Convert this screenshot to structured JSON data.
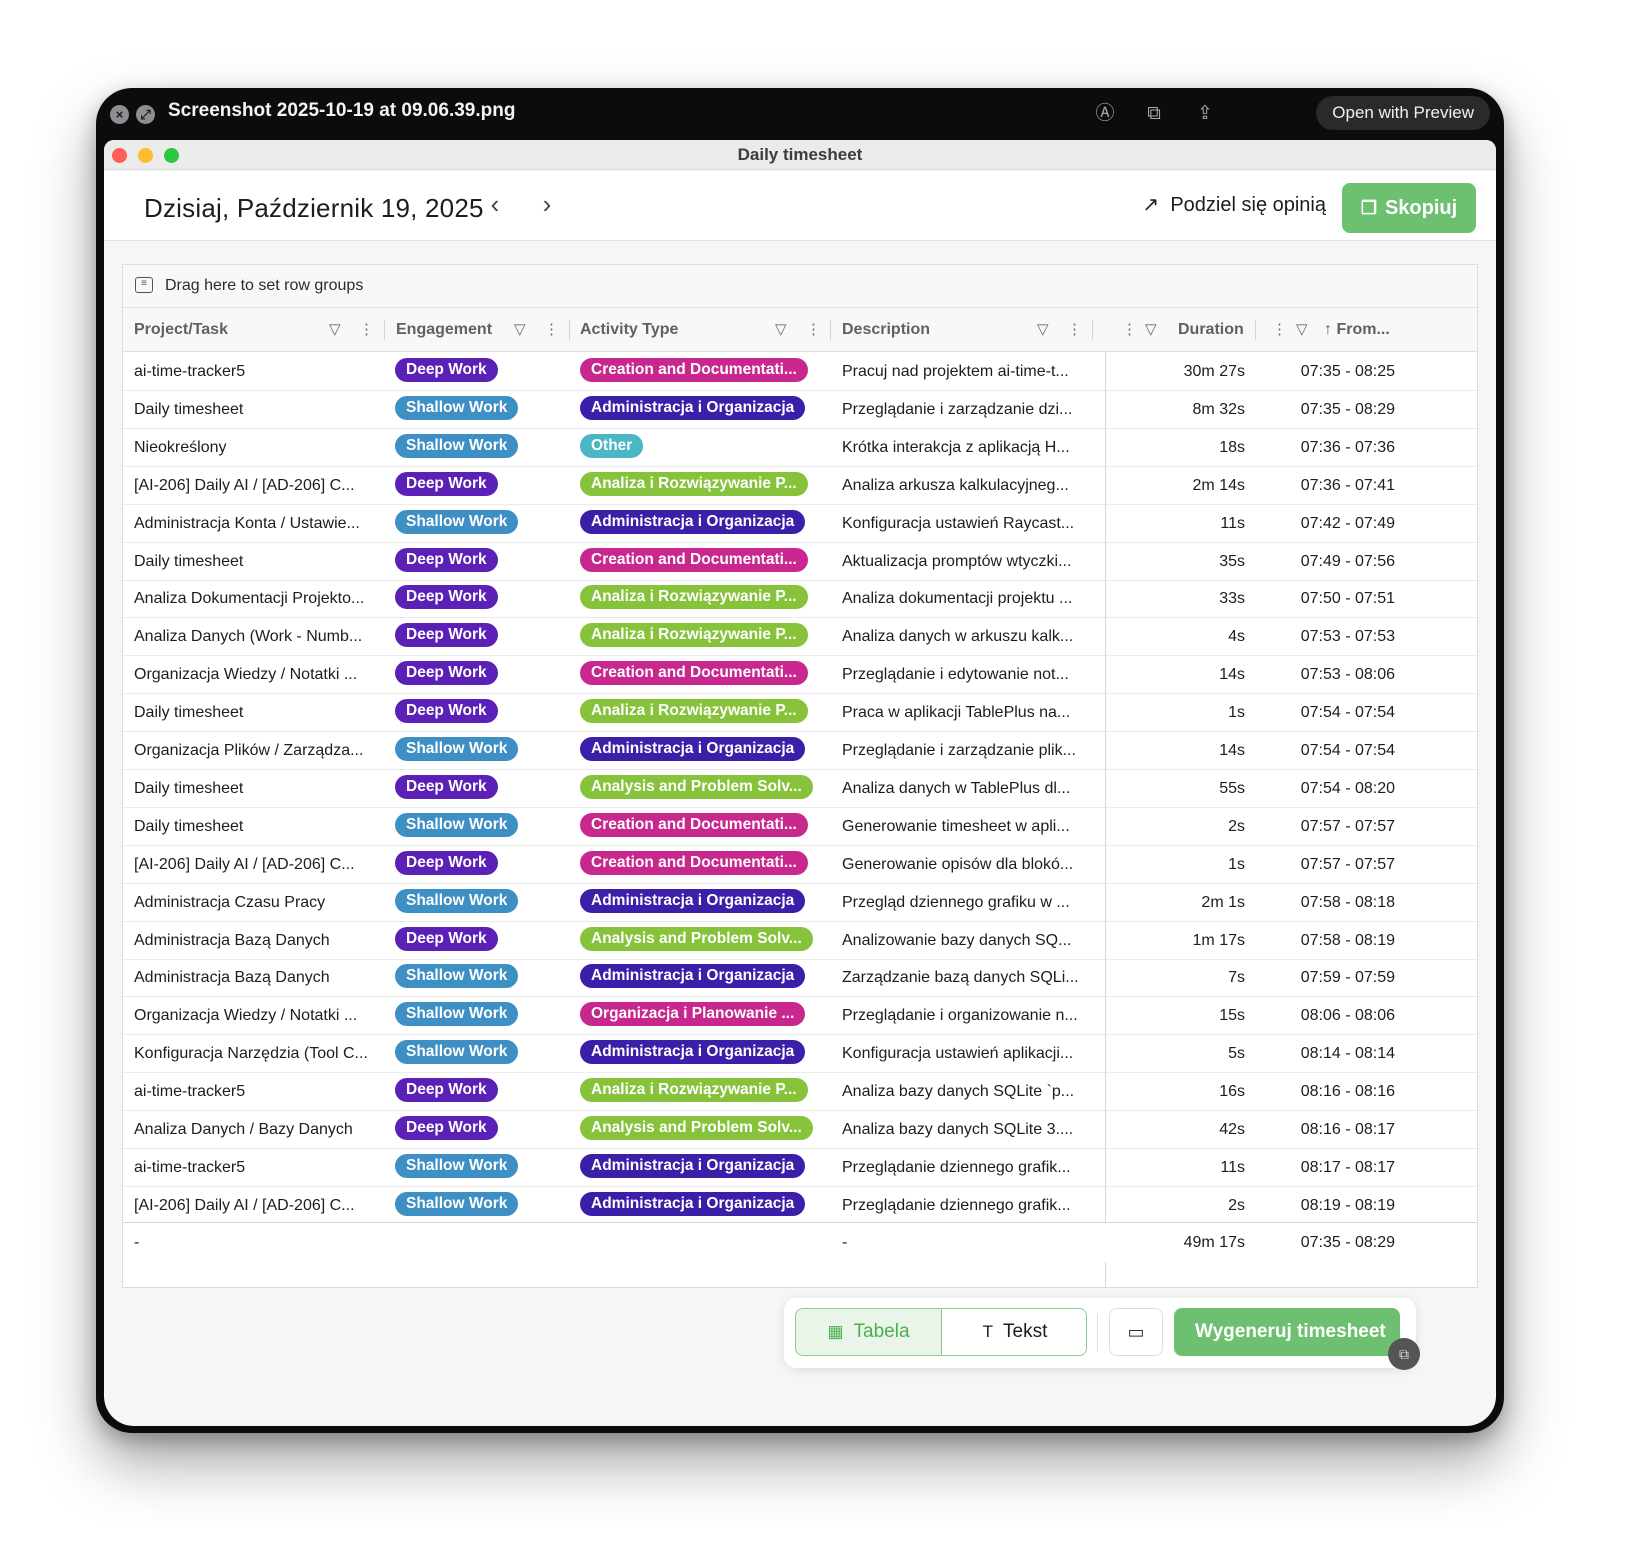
{
  "quicklook": {
    "title": "Screenshot 2025-10-19 at 09.06.39.png",
    "open_button": "Open with Preview"
  },
  "window": {
    "title": "Daily timesheet"
  },
  "header": {
    "date": "Dzisiaj, Październik 19, 2025",
    "share_label": "Podziel się opinią",
    "copy_label": "Skopiuj"
  },
  "grid": {
    "group_hint": "Drag here to set row groups",
    "columns": {
      "project": "Project/Task",
      "engagement": "Engagement",
      "activity": "Activity Type",
      "description": "Description",
      "duration": "Duration",
      "from": "From..."
    },
    "rows": [
      {
        "project": "ai-time-tracker5",
        "engagement": "Deep Work",
        "activity": "Creation and Documentati...",
        "description": "Pracuj nad projektem ai-time-t...",
        "duration": "30m 27s",
        "time": "07:35 - 08:25"
      },
      {
        "project": "Daily timesheet",
        "engagement": "Shallow Work",
        "activity": "Administracja i Organizacja",
        "description": "Przeglądanie i zarządzanie dzi...",
        "duration": "8m 32s",
        "time": "07:35 - 08:29"
      },
      {
        "project": "Nieokreślony",
        "engagement": "Shallow Work",
        "activity": "Other",
        "description": "Krótka interakcja z aplikacją H...",
        "duration": "18s",
        "time": "07:36 - 07:36"
      },
      {
        "project": "[AI-206] Daily AI / [AD-206] C...",
        "engagement": "Deep Work",
        "activity": "Analiza i Rozwiązywanie P...",
        "description": "Analiza arkusza kalkulacyjneg...",
        "duration": "2m 14s",
        "time": "07:36 - 07:41"
      },
      {
        "project": "Administracja Konta / Ustawie...",
        "engagement": "Shallow Work",
        "activity": "Administracja i Organizacja",
        "description": "Konfiguracja ustawień Raycast...",
        "duration": "11s",
        "time": "07:42 - 07:49"
      },
      {
        "project": "Daily timesheet",
        "engagement": "Deep Work",
        "activity": "Creation and Documentati...",
        "description": "Aktualizacja promptów wtyczki...",
        "duration": "35s",
        "time": "07:49 - 07:56"
      },
      {
        "project": "Analiza Dokumentacji Projekto...",
        "engagement": "Deep Work",
        "activity": "Analiza i Rozwiązywanie P...",
        "description": "Analiza dokumentacji projektu ...",
        "duration": "33s",
        "time": "07:50 - 07:51"
      },
      {
        "project": "Analiza Danych (Work - Numb...",
        "engagement": "Deep Work",
        "activity": "Analiza i Rozwiązywanie P...",
        "description": "Analiza danych w arkuszu kalk...",
        "duration": "4s",
        "time": "07:53 - 07:53"
      },
      {
        "project": "Organizacja Wiedzy / Notatki ...",
        "engagement": "Deep Work",
        "activity": "Creation and Documentati...",
        "description": "Przeglądanie i edytowanie not...",
        "duration": "14s",
        "time": "07:53 - 08:06"
      },
      {
        "project": "Daily timesheet",
        "engagement": "Deep Work",
        "activity": "Analiza i Rozwiązywanie P...",
        "description": "Praca w aplikacji TablePlus na...",
        "duration": "1s",
        "time": "07:54 - 07:54"
      },
      {
        "project": "Organizacja Plików / Zarządza...",
        "engagement": "Shallow Work",
        "activity": "Administracja i Organizacja",
        "description": "Przeglądanie i zarządzanie plik...",
        "duration": "14s",
        "time": "07:54 - 07:54"
      },
      {
        "project": "Daily timesheet",
        "engagement": "Deep Work",
        "activity": "Analysis and Problem Solv...",
        "description": "Analiza danych w TablePlus dl...",
        "duration": "55s",
        "time": "07:54 - 08:20"
      },
      {
        "project": "Daily timesheet",
        "engagement": "Shallow Work",
        "activity": "Creation and Documentati...",
        "description": "Generowanie timesheet w apli...",
        "duration": "2s",
        "time": "07:57 - 07:57"
      },
      {
        "project": "[AI-206] Daily AI / [AD-206] C...",
        "engagement": "Deep Work",
        "activity": "Creation and Documentati...",
        "description": "Generowanie opisów dla blokó...",
        "duration": "1s",
        "time": "07:57 - 07:57"
      },
      {
        "project": "Administracja Czasu Pracy",
        "engagement": "Shallow Work",
        "activity": "Administracja i Organizacja",
        "description": "Przegląd dziennego grafiku w ...",
        "duration": "2m 1s",
        "time": "07:58 - 08:18"
      },
      {
        "project": "Administracja Bazą Danych",
        "engagement": "Deep Work",
        "activity": "Analysis and Problem Solv...",
        "description": "Analizowanie bazy danych SQ...",
        "duration": "1m 17s",
        "time": "07:58 - 08:19"
      },
      {
        "project": "Administracja Bazą Danych",
        "engagement": "Shallow Work",
        "activity": "Administracja i Organizacja",
        "description": "Zarządzanie bazą danych SQLi...",
        "duration": "7s",
        "time": "07:59 - 07:59"
      },
      {
        "project": "Organizacja Wiedzy / Notatki ...",
        "engagement": "Shallow Work",
        "activity": "Organizacja i Planowanie ...",
        "description": "Przeglądanie i organizowanie n...",
        "duration": "15s",
        "time": "08:06 - 08:06"
      },
      {
        "project": "Konfiguracja Narzędzia (Tool C...",
        "engagement": "Shallow Work",
        "activity": "Administracja i Organizacja",
        "description": "Konfiguracja ustawień aplikacji...",
        "duration": "5s",
        "time": "08:14 - 08:14"
      },
      {
        "project": "ai-time-tracker5",
        "engagement": "Deep Work",
        "activity": "Analiza i Rozwiązywanie P...",
        "description": "Analiza bazy danych SQLite `p...",
        "duration": "16s",
        "time": "08:16 - 08:16"
      },
      {
        "project": "Analiza Danych / Bazy Danych",
        "engagement": "Deep Work",
        "activity": "Analysis and Problem Solv...",
        "description": "Analiza bazy danych SQLite 3....",
        "duration": "42s",
        "time": "08:16 - 08:17"
      },
      {
        "project": "ai-time-tracker5",
        "engagement": "Shallow Work",
        "activity": "Administracja i Organizacja",
        "description": "Przeglądanie dziennego grafik...",
        "duration": "11s",
        "time": "08:17 - 08:17"
      },
      {
        "project": "[AI-206] Daily AI / [AD-206] C...",
        "engagement": "Shallow Work",
        "activity": "Administracja i Organizacja",
        "description": "Przeglądanie dziennego grafik...",
        "duration": "2s",
        "time": "08:19 - 08:19"
      }
    ],
    "totals": {
      "project": "-",
      "description": "-",
      "duration": "49m 17s",
      "time": "07:35 - 08:29"
    }
  },
  "toolbar": {
    "tab_table": "Tabela",
    "tab_text": "Tekst",
    "generate_label": "Wygeneruj timesheet"
  },
  "colors": {
    "deep_work": "#5b21b6",
    "shallow_work": "#3d8fc4",
    "creation": "#c8288e",
    "administration": "#3b1fa8",
    "analysis": "#86c23a",
    "other": "#4bb6c4",
    "planning": "#c8288e",
    "accent_green": "#6cc070"
  }
}
